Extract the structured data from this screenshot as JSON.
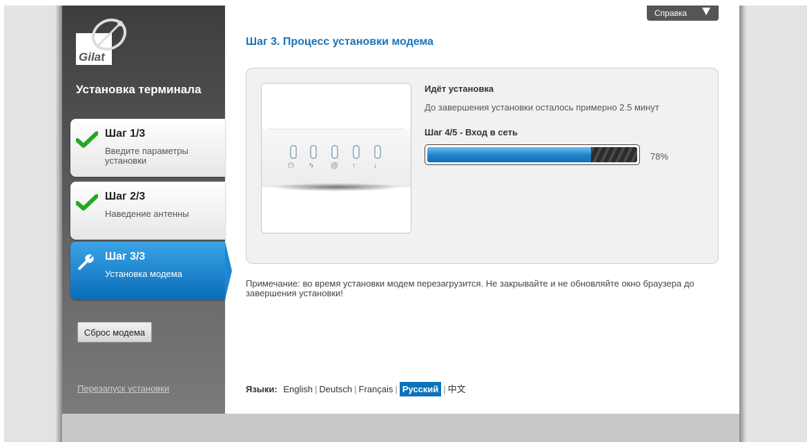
{
  "brand": {
    "logo_text": "Gilat"
  },
  "sidebar": {
    "title": "Установка терминала",
    "steps": [
      {
        "title": "Шаг 1/3",
        "desc": "Введите параметры установки",
        "status": "done"
      },
      {
        "title": "Шаг 2/3",
        "desc": "Наведение антенны",
        "status": "done"
      },
      {
        "title": "Шаг 3/3",
        "desc": "Установка модема",
        "status": "active"
      }
    ],
    "reset_button": "Сброс модема",
    "restart_link": "Перезапуск установки"
  },
  "header": {
    "help_label": "Справка"
  },
  "main": {
    "title": "Шаг 3. Процесс установки модема",
    "status_heading": "Идёт установка",
    "status_text": "До завершения установки осталось примерно 2.5 минут",
    "step_heading": "Шаг 4/5 - Вход в сеть",
    "progress_value": 0.78,
    "progress_label": "78%",
    "modem_icons": [
      "power-icon",
      "lightning-icon",
      "at-icon",
      "upload-arrow-icon",
      "download-arrow-icon"
    ],
    "note": "Примечание: во время установки модем перезагрузится. Не закрывайте и не обновляйте окно браузера до завершения установки!"
  },
  "languages": {
    "label": "Языки:",
    "items": [
      "English",
      "Deutsch",
      "Français",
      "Русский",
      "中文"
    ],
    "active": "Русский"
  },
  "colors": {
    "accent": "#1a73b8",
    "active_step": "#0a6cb8",
    "check": "#23a923",
    "progress": "#1f82cc"
  }
}
